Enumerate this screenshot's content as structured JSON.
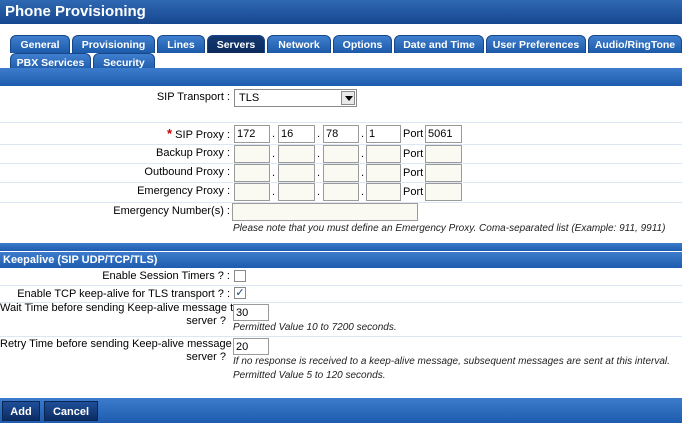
{
  "window": {
    "title": "Phone Provisioning"
  },
  "tabs": [
    {
      "label": "General"
    },
    {
      "label": "Provisioning"
    },
    {
      "label": "Lines"
    },
    {
      "label": "Servers"
    },
    {
      "label": "Network"
    },
    {
      "label": "Options"
    },
    {
      "label": "Date and Time"
    },
    {
      "label": "User Preferences"
    },
    {
      "label": "Audio/RingTone"
    },
    {
      "label": "PBX Services"
    },
    {
      "label": "Security"
    }
  ],
  "active_tab": "Servers",
  "sip_transport": {
    "label": "SIP Transport :",
    "value": "TLS"
  },
  "sip_proxy": {
    "label": "SIP Proxy :",
    "required_mark": "*",
    "ip": [
      "172",
      "16",
      "78",
      "1"
    ],
    "port_label": "Port",
    "port": "5061"
  },
  "backup_proxy": {
    "label": "Backup Proxy :",
    "ip": [
      "",
      "",
      "",
      ""
    ],
    "port_label": "Port",
    "port": ""
  },
  "outbound_proxy": {
    "label": "Outbound Proxy :",
    "ip": [
      "",
      "",
      "",
      ""
    ],
    "port_label": "Port",
    "port": ""
  },
  "emergency_proxy": {
    "label": "Emergency Proxy :",
    "ip": [
      "",
      "",
      "",
      ""
    ],
    "port_label": "Port",
    "port": ""
  },
  "ip_dot": ".",
  "emergency_numbers": {
    "label": "Emergency Number(s) :",
    "value": "",
    "note": "Please note that you must define an Emergency Proxy. Coma-separated list (Example: 911, 9911)"
  },
  "keepalive": {
    "title": "Keepalive (SIP UDP/TCP/TLS)",
    "session_timers": {
      "label": "Enable Session Timers ? :",
      "checked": false
    },
    "tcp_keepalive": {
      "label": "Enable TCP keep-alive for TLS transport ? :",
      "checked": true,
      "mark": "✓"
    },
    "wait_time": {
      "label_line1": "Wait Time before sending Keep-alive message to",
      "label_line2": "server ?",
      "value": "30",
      "note": "Permitted Value 10 to 7200 seconds."
    },
    "retry_time": {
      "label_line1": "Retry Time before sending Keep-alive message to",
      "label_line2": "server ?",
      "value": "20",
      "note_line1": "If no response is received to a keep-alive message, subsequent messages are sent at this interval.",
      "note_line2": "Permitted Value 5 to 120 seconds."
    }
  },
  "buttons": {
    "add": "Add",
    "cancel": "Cancel"
  },
  "colors": {
    "accent": "#1d5cae",
    "tab_active": "#0b2a5a",
    "required": "#cc0000"
  }
}
